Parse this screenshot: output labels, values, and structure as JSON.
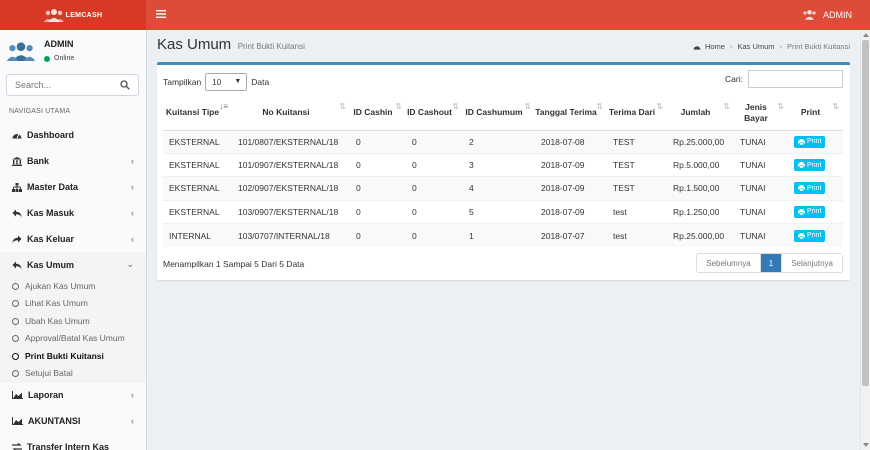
{
  "header": {
    "logo_text": "LEMCASH",
    "user_name": "ADMIN"
  },
  "sidebar": {
    "user": {
      "name": "ADMIN",
      "status": "Online"
    },
    "search_placeholder": "Search...",
    "nav_header": "NAVIGASI UTAMA",
    "items": [
      {
        "label": "Dashboard",
        "icon": "dashboard-icon",
        "chevron": ""
      },
      {
        "label": "Bank",
        "icon": "bank-icon",
        "chevron": "‹"
      },
      {
        "label": "Master Data",
        "icon": "sitemap-icon",
        "chevron": "‹"
      },
      {
        "label": "Kas Masuk",
        "icon": "reply-icon",
        "chevron": "‹"
      },
      {
        "label": "Kas Keluar",
        "icon": "share-icon",
        "chevron": "‹"
      },
      {
        "label": "Kas Umum",
        "icon": "reply-icon",
        "chevron": "‹"
      },
      {
        "label": "Laporan",
        "icon": "area-chart-icon",
        "chevron": "‹"
      },
      {
        "label": "AKUNTANSI",
        "icon": "area-chart-icon",
        "chevron": "‹"
      },
      {
        "label": "Transfer Intern Kas",
        "icon": "exchange-icon",
        "chevron": ""
      }
    ],
    "submenu": [
      "Ajukan Kas Umum",
      "Lihat Kas Umum",
      "Ubah Kas Umum",
      "Approval/Batal Kas Umum",
      "Print Bukti Kuitansi",
      "Setujui Batal"
    ]
  },
  "content": {
    "title": "Kas Umum",
    "subtitle": "Print Bukti Kuitansi",
    "breadcrumb": {
      "home": "Home",
      "parent": "Kas Umum",
      "current": "Print Bukti Kuitansi"
    }
  },
  "table": {
    "length_label": "Tampilkan",
    "length_value": "10",
    "length_suffix": "Data",
    "search_label": "Cari:",
    "columns": [
      "Kuitansi Tipe",
      "No Kuitansi",
      "ID Cashin",
      "ID Cashout",
      "ID Cashumum",
      "Tanggal Terima",
      "Terima Dari",
      "Jumlah",
      "Jenis Bayar",
      "Print"
    ],
    "rows": [
      [
        "EKSTERNAL",
        "101/0807/EKSTERNAL/18",
        "0",
        "0",
        "2",
        "2018-07-08",
        "TEST",
        "Rp.25.000,00",
        "TUNAI",
        "Print"
      ],
      [
        "EKSTERNAL",
        "101/0907/EKSTERNAL/18",
        "0",
        "0",
        "3",
        "2018-07-09",
        "TEST",
        "Rp.5.000,00",
        "TUNAI",
        "Print"
      ],
      [
        "EKSTERNAL",
        "102/0907/EKSTERNAL/18",
        "0",
        "0",
        "4",
        "2018-07-09",
        "TEST",
        "Rp.1.500,00",
        "TUNAI",
        "Print"
      ],
      [
        "EKSTERNAL",
        "103/0907/EKSTERNAL/18",
        "0",
        "0",
        "5",
        "2018-07-09",
        "test",
        "Rp.1.250,00",
        "TUNAI",
        "Print"
      ],
      [
        "INTERNAL",
        "103/0707/INTERNAL/18",
        "0",
        "0",
        "1",
        "2018-07-07",
        "test",
        "Rp.25.000,00",
        "TUNAI",
        "Print"
      ]
    ],
    "info": "Menampilkan 1 Sampai 5 Dari 5 Data",
    "pager": {
      "prev": "Sebelumnya",
      "current": "1",
      "next": "Selanjutnya"
    }
  },
  "colors": {
    "header_bg": "#dd4b39",
    "logo_bg": "#d73925",
    "box_border": "#3c8dbc",
    "print_button": "#00c0ef",
    "page_active": "#337ab7"
  }
}
